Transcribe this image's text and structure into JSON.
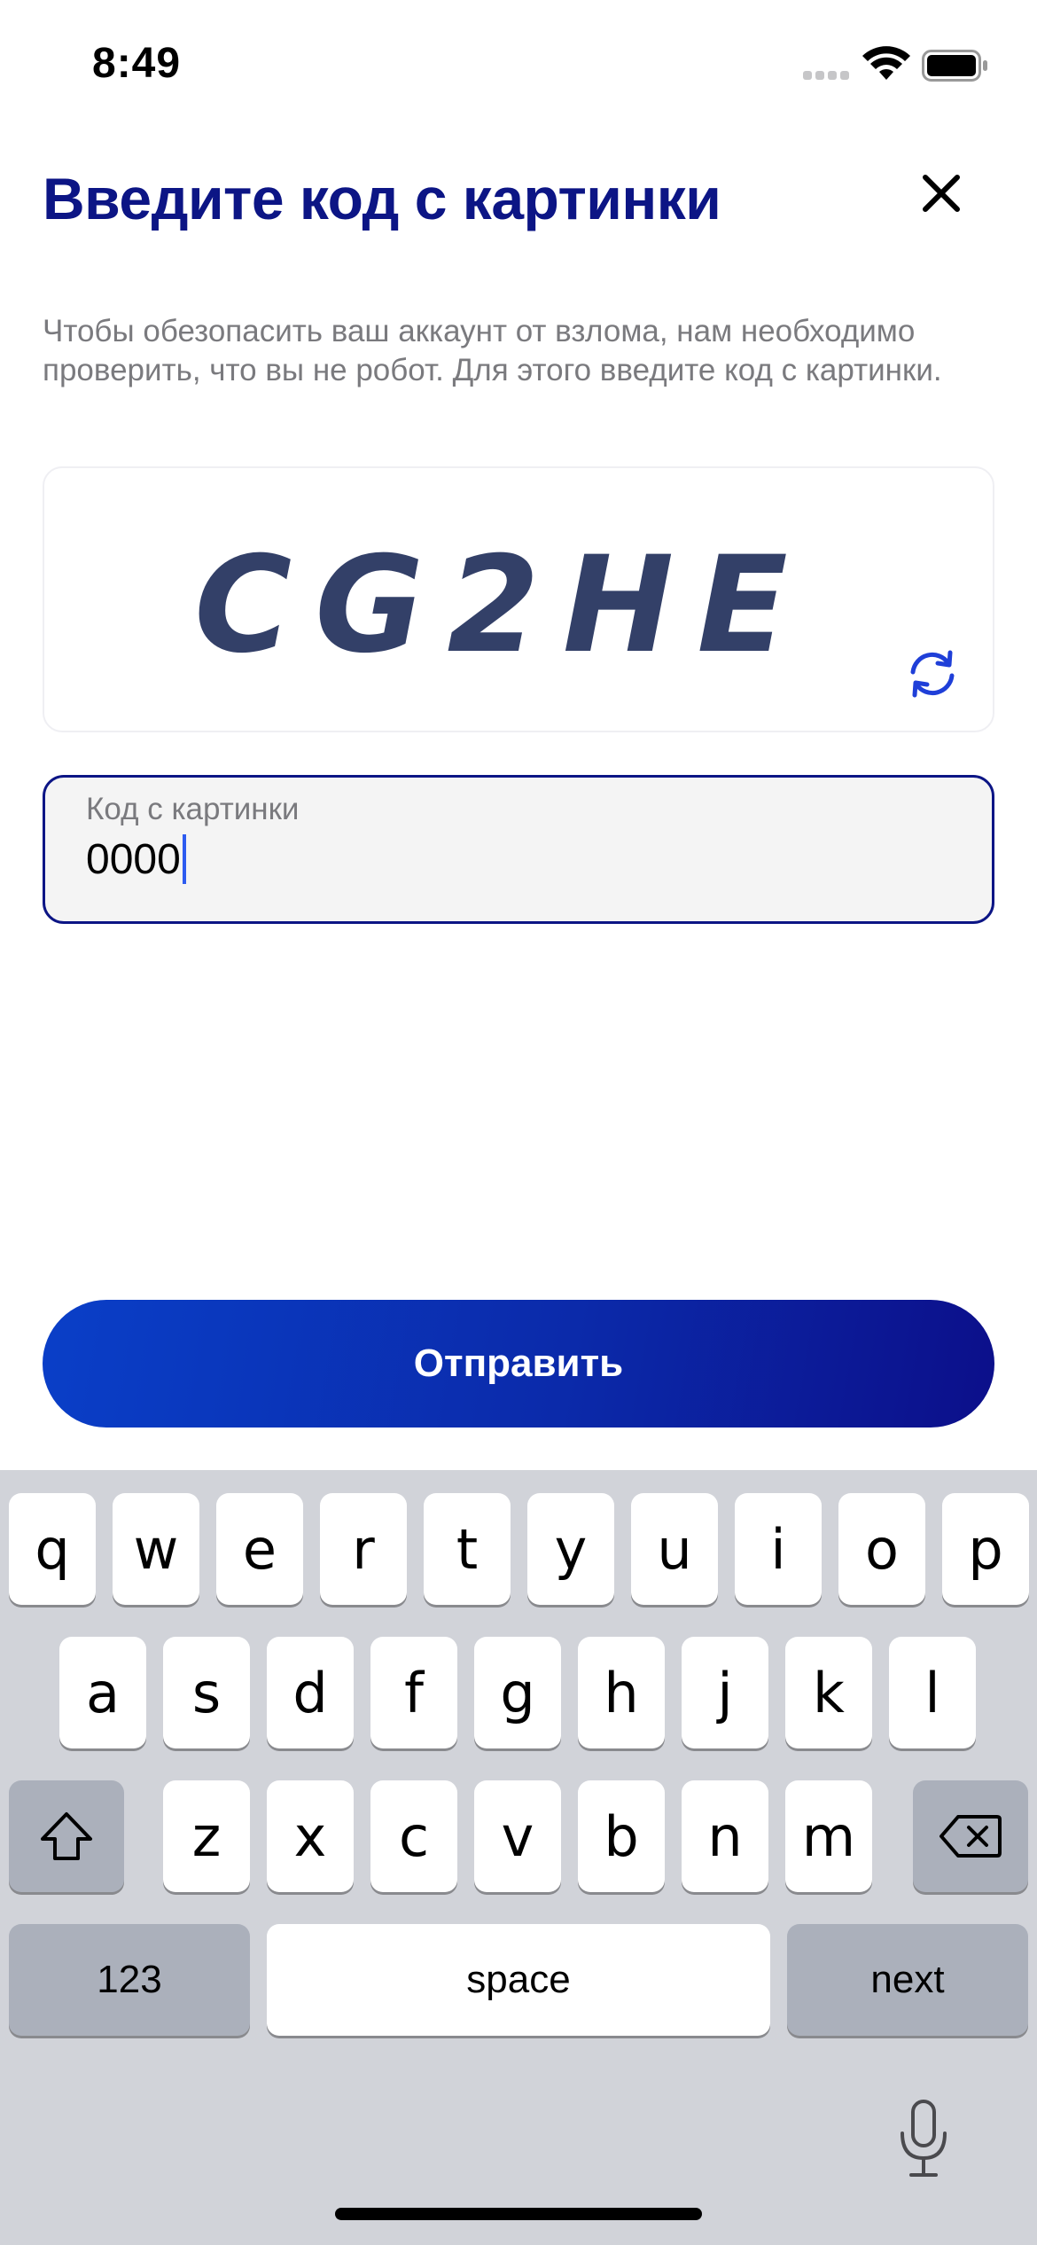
{
  "status_bar": {
    "time": "8:49",
    "icons": [
      "cellular-signal-icon",
      "wifi-icon",
      "battery-icon"
    ]
  },
  "header": {
    "title": "Введите код с картинки",
    "close_icon": "close-icon"
  },
  "description": "Чтобы обезопасить ваш аккаунт от взлома, нам необходимо проверить, что вы не робот. Для этого введите код с картинки.",
  "captcha": {
    "image_text": "CG2HE",
    "refresh_icon": "refresh-icon"
  },
  "code_input": {
    "label": "Код с картинки",
    "value": "0000"
  },
  "submit_label": "Отправить",
  "keyboard": {
    "row1": [
      "q",
      "w",
      "e",
      "r",
      "t",
      "y",
      "u",
      "i",
      "o",
      "p"
    ],
    "row2": [
      "a",
      "s",
      "d",
      "f",
      "g",
      "h",
      "j",
      "k",
      "l"
    ],
    "row3": [
      "z",
      "x",
      "c",
      "v",
      "b",
      "n",
      "m"
    ],
    "numbers_label": "123",
    "space_label": "space",
    "next_label": "next",
    "shift_icon": "shift-icon",
    "backspace_icon": "backspace-icon",
    "mic_icon": "microphone-icon"
  },
  "colors": {
    "accent": "#0c1585",
    "button_start": "#0a3fc8",
    "button_end": "#0c0f8a",
    "caret": "#2d5bf0"
  }
}
